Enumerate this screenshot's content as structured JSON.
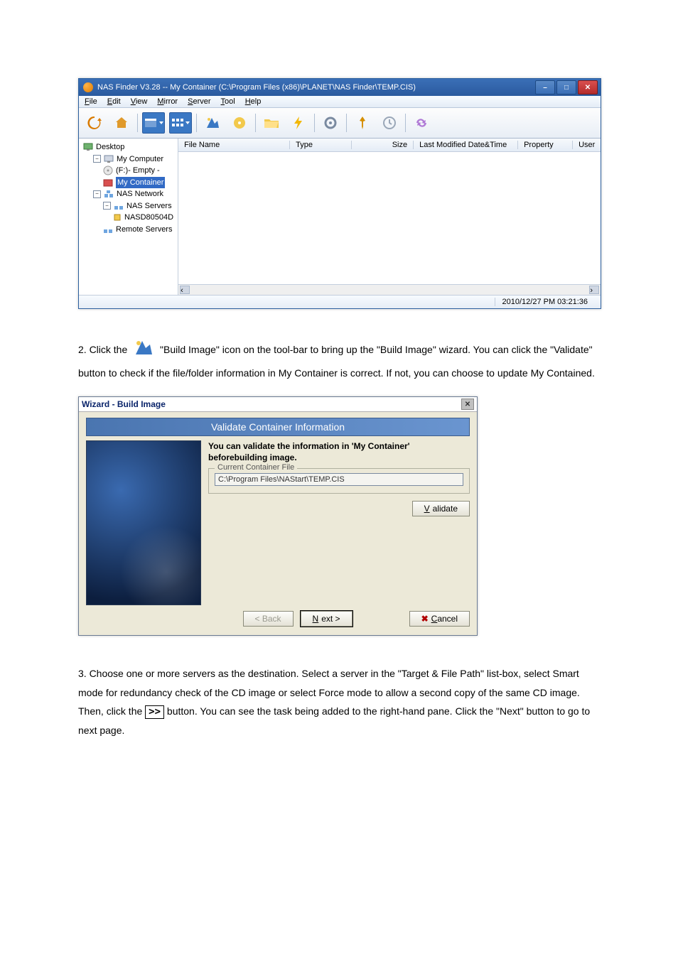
{
  "screenshot1": {
    "window_title": "NAS Finder V3.28  --  My Container (C:\\Program Files (x86)\\PLANET\\NAS Finder\\TEMP.CIS)",
    "menu": [
      "File",
      "Edit",
      "View",
      "Mirror",
      "Server",
      "Tool",
      "Help"
    ],
    "tree": {
      "root": "Desktop",
      "items": [
        {
          "label": "My Computer"
        },
        {
          "label": "(F:)- Empty -"
        },
        {
          "label": "My Container",
          "highlight": true
        },
        {
          "label": "NAS Network"
        },
        {
          "label": "NAS Servers"
        },
        {
          "label": "NASD80504D"
        },
        {
          "label": "Remote Servers"
        }
      ]
    },
    "list_columns": [
      "File Name",
      "Type",
      "Size",
      "Last Modified Date&Time",
      "Property",
      "User"
    ],
    "status_time": "2010/12/27  PM 03:21:36"
  },
  "step2": {
    "lead": "2. Click the ",
    "tail1": " \"Build Image\" icon on the tool-bar to bring up the \"Build Image\" wizard. You can click the \"Validate\" button to check if the file/folder information in My Container is correct. If not, you can choose to update My Contained."
  },
  "wizard": {
    "title": "Wizard - Build Image",
    "banner": "Validate Container Information",
    "desc": "You can validate the information in 'My Container' beforebuilding image.",
    "group_legend": "Current Container File",
    "path": "C:\\Program Files\\NAStart\\TEMP.CIS",
    "validate_btn": "Validate",
    "back_btn": "< Back",
    "next_btn": "Next >",
    "cancel_btn": "Cancel"
  },
  "step3": {
    "text1": "3. Choose one or more servers as the destination. Select a server in the \"Target & File Path\" list-box, select Smart mode for redundancy check of the CD image or select Force mode to allow a second copy of the same CD image. Then, click the ",
    "inline_btn": ">>",
    "text2": " button. You can see the task being added to the right-hand pane. Click the \"Next\" button to go to next page."
  }
}
